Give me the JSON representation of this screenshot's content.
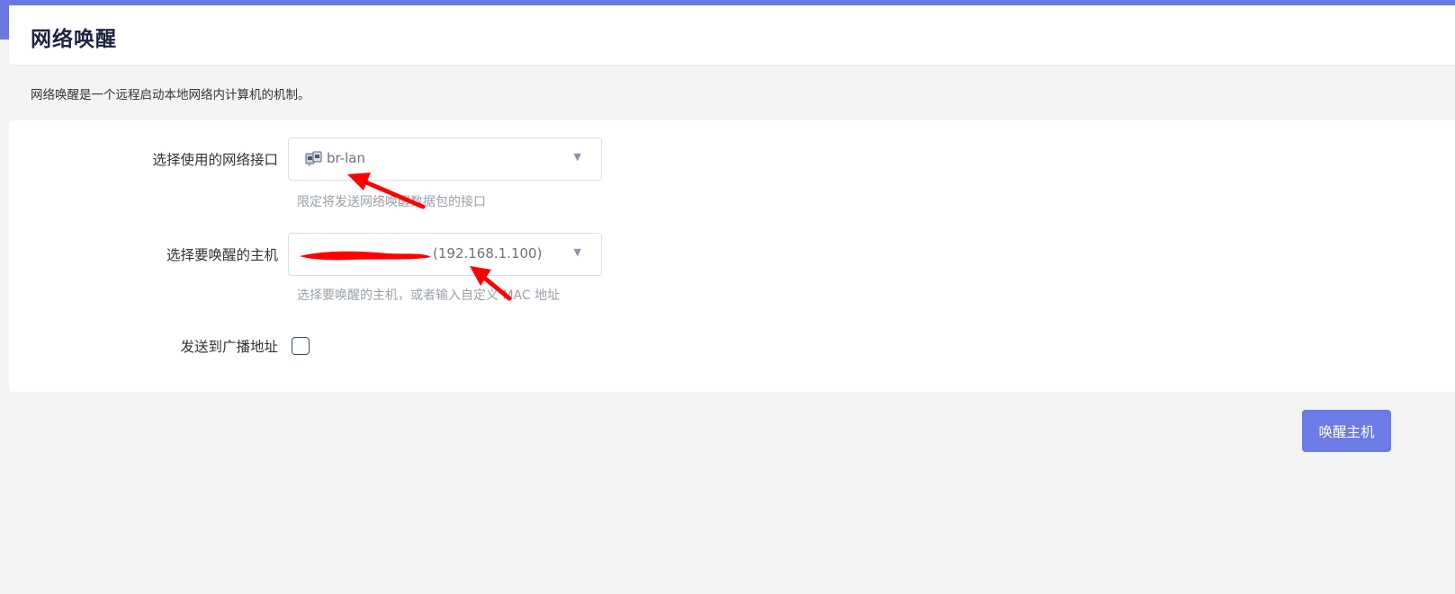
{
  "page": {
    "title": "网络唤醒",
    "description": "网络唤醒是一个远程启动本地网络内计算机的机制。"
  },
  "form": {
    "interface": {
      "label": "选择使用的网络接口",
      "value": "br-lan",
      "hint": "限定将发送网络唤醒数据包的接口",
      "icon": "network-interface-icon"
    },
    "host": {
      "label": "选择要唤醒的主机",
      "value_visible": "(192.168.1.100)",
      "hint": "选择要唤醒的主机，或者输入自定义 MAC 地址"
    },
    "broadcast": {
      "label": "发送到广播地址",
      "checked": false
    }
  },
  "actions": {
    "wake_label": "唤醒主机"
  },
  "colors": {
    "accent": "#6a78e6",
    "button": "#6c7be6",
    "annotation": "#ff0000"
  }
}
